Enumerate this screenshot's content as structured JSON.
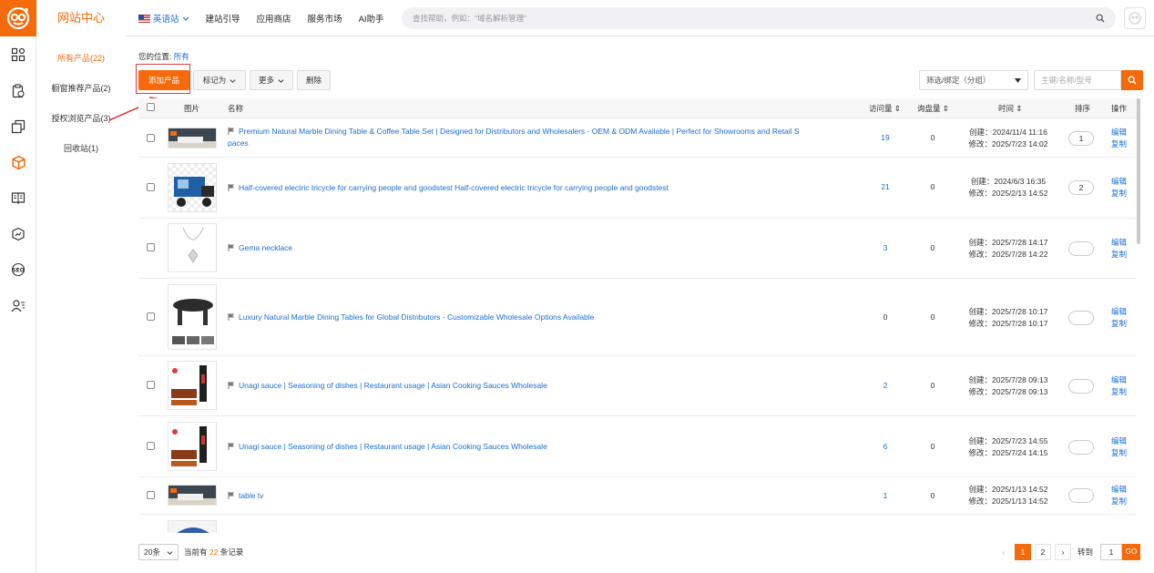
{
  "header": {
    "site_title": "网站中心",
    "nav": [
      {
        "label": "英语站",
        "icon": "us-flag-icon"
      },
      {
        "label": "建站引导"
      },
      {
        "label": "应用商店"
      },
      {
        "label": "服务市场"
      },
      {
        "label": "AI助手"
      }
    ],
    "search_placeholder": "查找帮助，例如：\"域名解析管理\""
  },
  "sidebar_icons": [
    "dashboard-icon",
    "clipboard-icon",
    "pages-icon",
    "product-cube-icon",
    "book-icon",
    "chart-icon",
    "seo-icon",
    "users-icon"
  ],
  "subnav": [
    {
      "label": "所有产品(22)",
      "active": true
    },
    {
      "label": "橱窗推荐产品(2)"
    },
    {
      "label": "授权浏览产品(3)"
    },
    {
      "label": "回收站(1)"
    }
  ],
  "breadcrumb": {
    "prefix": "您的位置:",
    "link": "所有"
  },
  "toolbar": {
    "add_label": "添加产品",
    "mark_label": "标记为",
    "more_label": "更多",
    "delete_label": "删除",
    "filter_label": "筛选/绑定（分组）",
    "keyword_placeholder": "主键/名称/型号"
  },
  "table": {
    "headers": {
      "image": "图片",
      "name": "名称",
      "visits": "访问量",
      "inquiries": "询盘量",
      "time": "时间",
      "sort": "排序",
      "ops": "操作"
    },
    "rows": [
      {
        "name": "Premium Natural Marble Dining Table & Coffee Table Set | Designed for Distributors and Wholesalers - OEM & ODM Available | Perfect for Showrooms and Retail S",
        "name2": "paces",
        "visits": "19",
        "inquiries": "0",
        "created": "创建：2024/11/4 11:16",
        "modified": "修改：2025/7/23 14:02",
        "sort": "1",
        "edit": "编辑",
        "copy": "复制"
      },
      {
        "name": "Half-covered electric tricycle for carrying people and goodstest Half-covered electric tricycle for carrying people and goodstest",
        "name2": "",
        "visits": "21",
        "inquiries": "0",
        "created": "创建：2024/6/3 16:35",
        "modified": "修改：2025/2/13 14:52",
        "sort": "2",
        "edit": "编辑",
        "copy": "复制"
      },
      {
        "name": "Gema necklace",
        "name2": "",
        "visits": "3",
        "inquiries": "0",
        "created": "创建：2025/7/28 14:17",
        "modified": "修改：2025/7/28 14:22",
        "sort": "",
        "edit": "编辑",
        "copy": "复制"
      },
      {
        "name": "Luxury Natural Marble Dining Tables for Global Distributors - Customizable Wholesale Options Available",
        "name2": "",
        "visits": "0",
        "inquiries": "0",
        "created": "创建：2025/7/28 10:17",
        "modified": "修改：2025/7/28 10:17",
        "sort": "",
        "edit": "编辑",
        "copy": "复制"
      },
      {
        "name": "Unagi sauce | Seasoning of dishes | Restaurant usage | Asian Cooking Sauces Wholesale",
        "name2": "",
        "visits": "2",
        "inquiries": "0",
        "created": "创建：2025/7/28 09:13",
        "modified": "修改：2025/7/28 09:13",
        "sort": "",
        "edit": "编辑",
        "copy": "复制"
      },
      {
        "name": "Unagi sauce | Seasoning of dishes | Restaurant usage | Asian Cooking Sauces Wholesale",
        "name2": "",
        "visits": "6",
        "inquiries": "0",
        "created": "创建：2025/7/23 14:55",
        "modified": "修改：2025/7/24 14:15",
        "sort": "",
        "edit": "编辑",
        "copy": "复制"
      },
      {
        "name": "table tv",
        "name2": "",
        "visits": "1",
        "inquiries": "0",
        "created": "创建：2025/1/13 14:52",
        "modified": "修改：2025/1/13 14:52",
        "sort": "",
        "edit": "编辑",
        "copy": "复制"
      }
    ]
  },
  "footer": {
    "page_size": "20条",
    "total_prefix": "当前有",
    "total_count": "22",
    "total_suffix": "条记录",
    "prev": "‹",
    "pages": [
      "1",
      "2"
    ],
    "next": "›",
    "goto_label": "转到",
    "goto_value": "1",
    "goto_btn": "GO"
  },
  "colors": {
    "accent": "#f56a0a",
    "link": "#1a6fd6",
    "highlight": "#e03b3b"
  }
}
